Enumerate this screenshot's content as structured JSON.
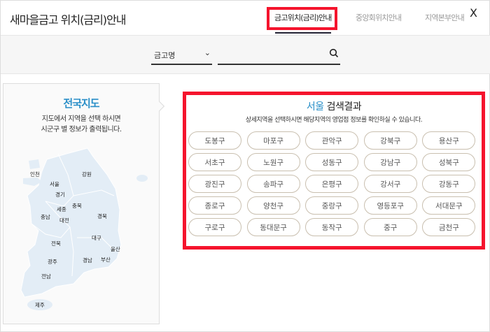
{
  "header": {
    "title": "새마을금고 위치(금리)안내",
    "tabs": [
      {
        "label": "금고위치(금리)안내",
        "active": true
      },
      {
        "label": "중앙회위치안내"
      },
      {
        "label": "지역본부안내"
      }
    ],
    "close": "X"
  },
  "search": {
    "select_value": "금고명",
    "input_value": "",
    "chevron": "⌄"
  },
  "map": {
    "title": "전국지도",
    "desc_line1": "지도에서 지역을 선택 하시면",
    "desc_line2": "시군구 별 정보가 출력됩니다.",
    "regions": [
      "인천",
      "서울",
      "경기",
      "강원",
      "세종",
      "충북",
      "충남",
      "대전",
      "경북",
      "대구",
      "전북",
      "울산",
      "광주",
      "경남",
      "부산",
      "전남",
      "제주"
    ]
  },
  "results": {
    "city": "서울",
    "title_suffix": "검색결과",
    "desc": "상세지역을 선택하시면 해당지역의 영업점 정보를 확인하실 수 있습니다.",
    "districts": [
      "도봉구",
      "마포구",
      "관악구",
      "강북구",
      "용산구",
      "서초구",
      "노원구",
      "성동구",
      "강남구",
      "성북구",
      "광진구",
      "송파구",
      "은평구",
      "강서구",
      "강동구",
      "종로구",
      "양천구",
      "중랑구",
      "영등포구",
      "서대문구",
      "구로구",
      "동대문구",
      "동작구",
      "중구",
      "금천구"
    ]
  },
  "colors": {
    "accent": "#2a8fc8",
    "highlight": "#f5142d",
    "pill_border": "#c9bfaf"
  }
}
